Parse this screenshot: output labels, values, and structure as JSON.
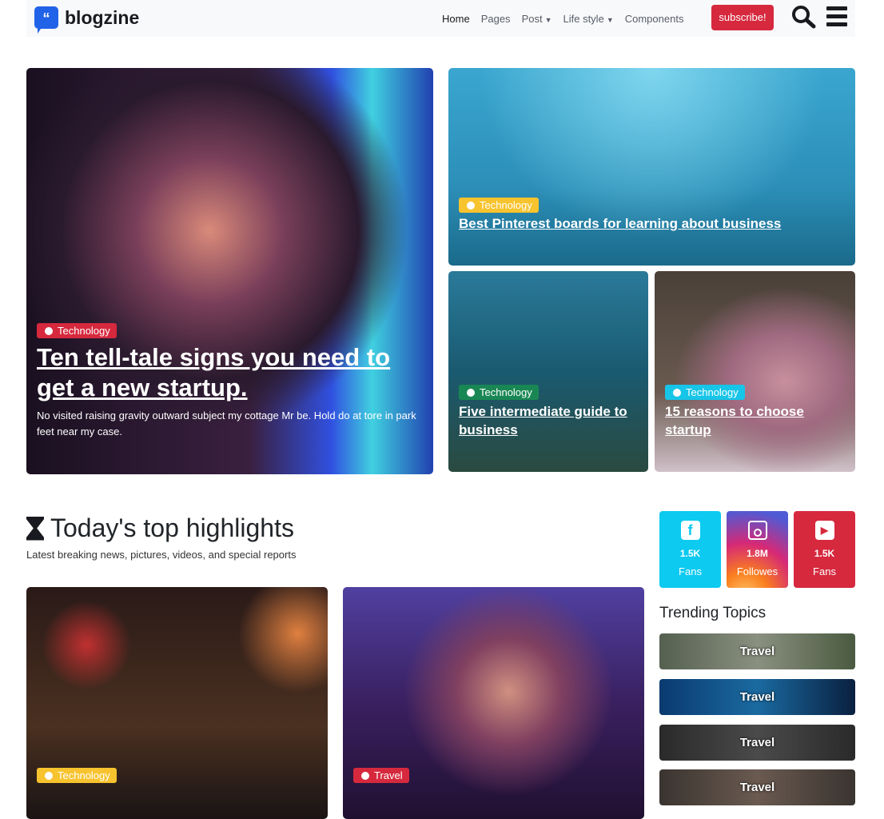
{
  "nav": {
    "brand": "blogzine",
    "items": [
      "Home",
      "Pages",
      "Post",
      "Life style",
      "Components"
    ],
    "subscribe": "subscribe!"
  },
  "hero": {
    "badge": "Technology",
    "title": "Ten tell-tale signs you need to get a new startup.",
    "desc": "No visited raising gravity outward subject my cottage Mr be. Hold do at tore in park feet near my case."
  },
  "top_right": {
    "badge": "Technology",
    "title": "Best Pinterest boards for learning about business"
  },
  "small1": {
    "badge": "Technology",
    "title": "Five intermediate guide to business"
  },
  "small2": {
    "badge": "Technology",
    "title": "15 reasons to choose startup"
  },
  "highlights": {
    "title": "Today's top highlights",
    "subtitle": "Latest breaking news, pictures, videos, and special reports",
    "cards": [
      {
        "badge": "Technology"
      },
      {
        "badge": "Travel"
      }
    ]
  },
  "social": [
    {
      "icon": "facebook-icon",
      "count": "1.5K",
      "label": "Fans"
    },
    {
      "icon": "instagram-icon",
      "count": "1.8M",
      "label": "Followes"
    },
    {
      "icon": "youtube-icon",
      "count": "1.5K",
      "label": "Fans"
    }
  ],
  "trending": {
    "title": "Trending Topics",
    "items": [
      "Travel",
      "Travel",
      "Travel",
      "Travel"
    ]
  },
  "colors": {
    "red": "#d6293e",
    "yellow": "#f7c32e",
    "green": "#0cbc87",
    "cyan": "#17c5e8",
    "blue": "#2163e8"
  }
}
